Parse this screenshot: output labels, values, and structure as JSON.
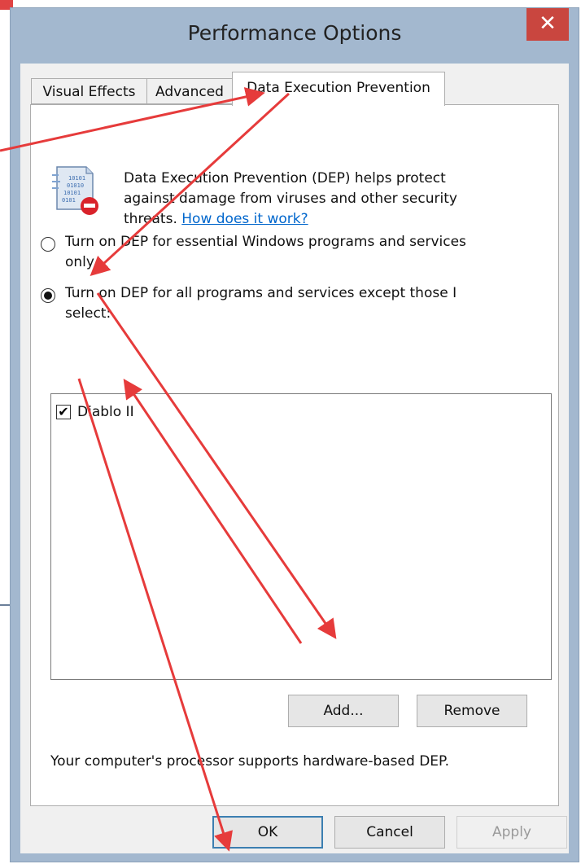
{
  "window": {
    "title": "Performance Options",
    "close_label": "✕"
  },
  "tabs": [
    {
      "label": "Visual Effects",
      "active": false
    },
    {
      "label": "Advanced",
      "active": false
    },
    {
      "label": "Data Execution Prevention",
      "active": true
    }
  ],
  "dep": {
    "description_line1": "Data Execution Prevention (DEP) helps protect",
    "description_line2": "against damage from viruses and other security",
    "description_line3_prefix": "threats. ",
    "help_link": "How does it work?",
    "icon": "dep-shield-icon",
    "option_essential_line1": "Turn on DEP for essential Windows programs and services",
    "option_essential_line2": "only",
    "option_all_line1": "Turn on DEP for all programs and services except those I",
    "option_all_line2": "select:",
    "selected_option": "all",
    "programs": [
      {
        "name": "Diablo II",
        "checked": true
      }
    ],
    "add_label": "Add...",
    "remove_label": "Remove",
    "status": "Your computer's processor supports hardware-based DEP."
  },
  "buttons": {
    "ok": "OK",
    "cancel": "Cancel",
    "apply": "Apply"
  },
  "colors": {
    "frame": "#a3b8cf",
    "close": "#c9463f",
    "arrow": "#e63b3b",
    "link": "#0066cc"
  }
}
